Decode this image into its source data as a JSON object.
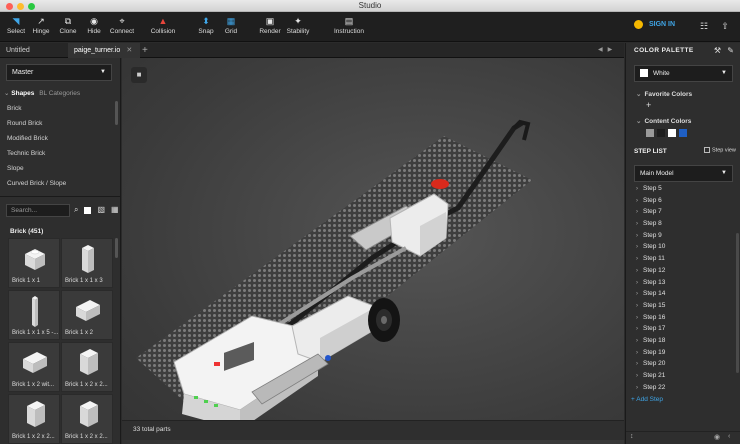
{
  "window": {
    "title": "Studio"
  },
  "toolbar": {
    "tools": [
      {
        "label": "Select",
        "icon": "cursor-icon"
      },
      {
        "label": "Hinge",
        "icon": "hinge-icon"
      },
      {
        "label": "Clone",
        "icon": "clone-icon"
      },
      {
        "label": "Hide",
        "icon": "eye-off-icon"
      },
      {
        "label": "Connect",
        "icon": "connect-icon"
      },
      {
        "label": "Collision",
        "icon": "warning-icon"
      },
      {
        "label": "Snap",
        "icon": "snap-icon"
      },
      {
        "label": "Grid",
        "icon": "grid-icon"
      },
      {
        "label": "Render",
        "icon": "camera-icon"
      },
      {
        "label": "Stability",
        "icon": "stability-icon"
      },
      {
        "label": "Instruction",
        "icon": "instruction-icon"
      }
    ],
    "signin_label": "SIGN IN"
  },
  "tabs": [
    {
      "label": "Untitled Model",
      "active": false
    },
    {
      "label": "paige_turner.io",
      "active": true
    }
  ],
  "left_panel": {
    "model_select": "Master",
    "shapes_tab": "Shapes",
    "categories_tab": "BL Categories",
    "shapes": [
      "Brick",
      "Round Brick",
      "Modified Brick",
      "Technic Brick",
      "Slope",
      "Curved Brick / Slope"
    ],
    "search_placeholder": "Search...",
    "brick_header": "Brick (451)",
    "bricks": [
      "Brick 1 x 1",
      "Brick 1 x 1 x 3",
      "Brick 1 x 1 x 5 -...",
      "Brick 1 x 2",
      "Brick 1 x 2 wit...",
      "Brick 1 x 2 x 2...",
      "Brick 1 x 2 x 2...",
      "Brick 1 x 2 x 2..."
    ]
  },
  "viewport": {
    "status": "33 total parts"
  },
  "right_panel": {
    "color_palette_label": "COLOR PALETTE",
    "selected_color": "White",
    "favorite_colors_label": "Favorite Colors",
    "content_colors_label": "Content Colors",
    "content_colors": [
      "#9a9a9a",
      "#1e1e1e",
      "#ffffff",
      "#1f5fc4"
    ],
    "step_list_label": "STEP LIST",
    "step_view_label": "Step view",
    "model_select": "Main Model",
    "steps": [
      "Step 5",
      "Step 6",
      "Step 7",
      "Step 8",
      "Step 9",
      "Step 10",
      "Step 11",
      "Step 12",
      "Step 13",
      "Step 14",
      "Step 15",
      "Step 16",
      "Step 17",
      "Step 18",
      "Step 19",
      "Step 20",
      "Step 21",
      "Step 22"
    ],
    "add_step_label": "+ Add Step"
  }
}
